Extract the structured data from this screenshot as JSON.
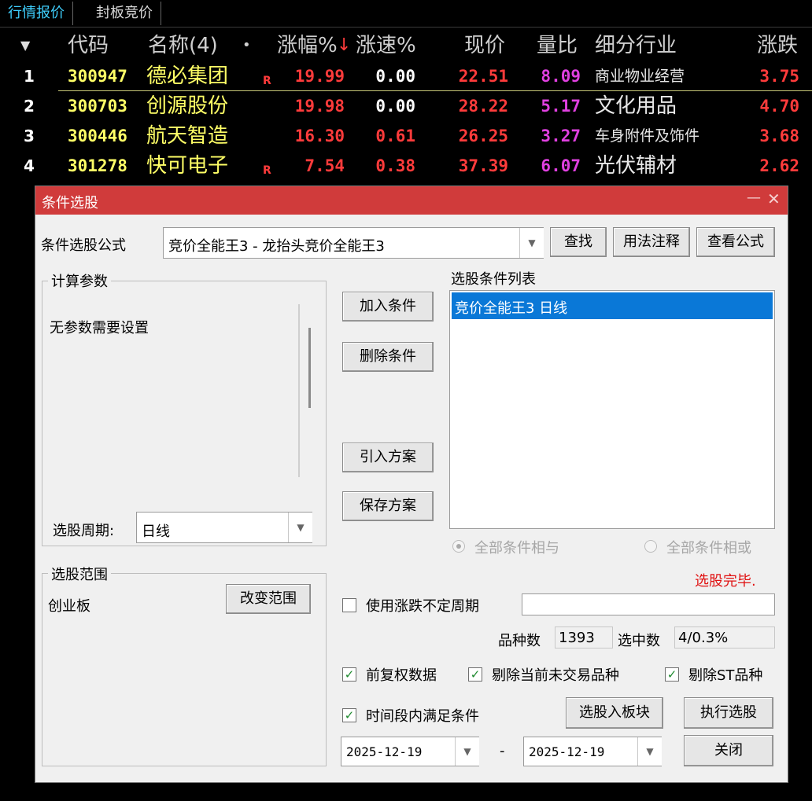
{
  "tabs": [
    "行情报价",
    "封板竞价"
  ],
  "table": {
    "headers": {
      "sort_arrow": "▼",
      "code": "代码",
      "name": "名称(4)",
      "dot": "•",
      "change_pct": "涨幅%",
      "sort_down": "↓",
      "speed_pct": "涨速%",
      "price": "现价",
      "volume_ratio": "量比",
      "industry": "细分行业",
      "change": "涨跌"
    },
    "rows": [
      {
        "idx": "1",
        "code": "300947",
        "name": "德必集团",
        "mark": "R",
        "change_pct": "19.99",
        "speed": "0.00",
        "price": "22.51",
        "vr": "8.09",
        "industry": "商业物业经营",
        "change": "3.75"
      },
      {
        "idx": "2",
        "code": "300703",
        "name": "创源股份",
        "mark": "",
        "change_pct": "19.98",
        "speed": "0.00",
        "price": "28.22",
        "vr": "5.17",
        "industry": "文化用品",
        "change": "4.70"
      },
      {
        "idx": "3",
        "code": "300446",
        "name": "航天智造",
        "mark": "",
        "change_pct": "16.30",
        "speed": "0.61",
        "price": "26.25",
        "vr": "3.27",
        "industry": "车身附件及饰件",
        "change": "3.68"
      },
      {
        "idx": "4",
        "code": "301278",
        "name": "快可电子",
        "mark": "R",
        "change_pct": "7.54",
        "speed": "0.38",
        "price": "37.39",
        "vr": "6.07",
        "industry": "光伏辅材",
        "change": "2.62"
      }
    ]
  },
  "dialog": {
    "title": "条件选股",
    "minimize": "—",
    "close": "✕",
    "formula_label": "条件选股公式",
    "formula_value": "竞价全能王3  -  龙抬头竞价全能王3",
    "find_btn": "查找",
    "usage_btn": "用法注释",
    "view_btn": "查看公式",
    "params_group": "计算参数",
    "params_text": "无参数需要设置",
    "period_label": "选股周期:",
    "period_value": "日线",
    "scope_group": "选股范围",
    "scope_value": "创业板",
    "change_scope_btn": "改变范围",
    "add_cond_btn": "加入条件",
    "del_cond_btn": "删除条件",
    "import_btn": "引入方案",
    "save_btn": "保存方案",
    "cond_list_label": "选股条件列表",
    "cond_items": [
      "竞价全能王3  日线"
    ],
    "radio_and": "全部条件相与",
    "radio_or": "全部条件相或",
    "status": "选股完毕.",
    "use_period_label": "使用涨跌不定周期",
    "count_label": "品种数",
    "count_value": "1393",
    "selected_label": "选中数",
    "selected_value": "4/0.3%",
    "cb_fq": "前复权数据",
    "cb_untraded": "剔除当前未交易品种",
    "cb_st": "剔除ST品种",
    "cb_timerange": "时间段内满足条件",
    "to_block_btn": "选股入板块",
    "run_btn": "执行选股",
    "date_from": "2025-12-19",
    "date_sep": "-",
    "date_to": "2025-12-19",
    "close_btn": "关闭",
    "check_glyph": "✓",
    "dd_glyph": "▼"
  },
  "colors": {
    "accent": "#3fd0ff",
    "red": "#ff3b3b",
    "yellow": "#ffff66",
    "magenta": "#e040e0",
    "title_red": "#d03b3b",
    "selection_blue": "#0a78d7"
  }
}
